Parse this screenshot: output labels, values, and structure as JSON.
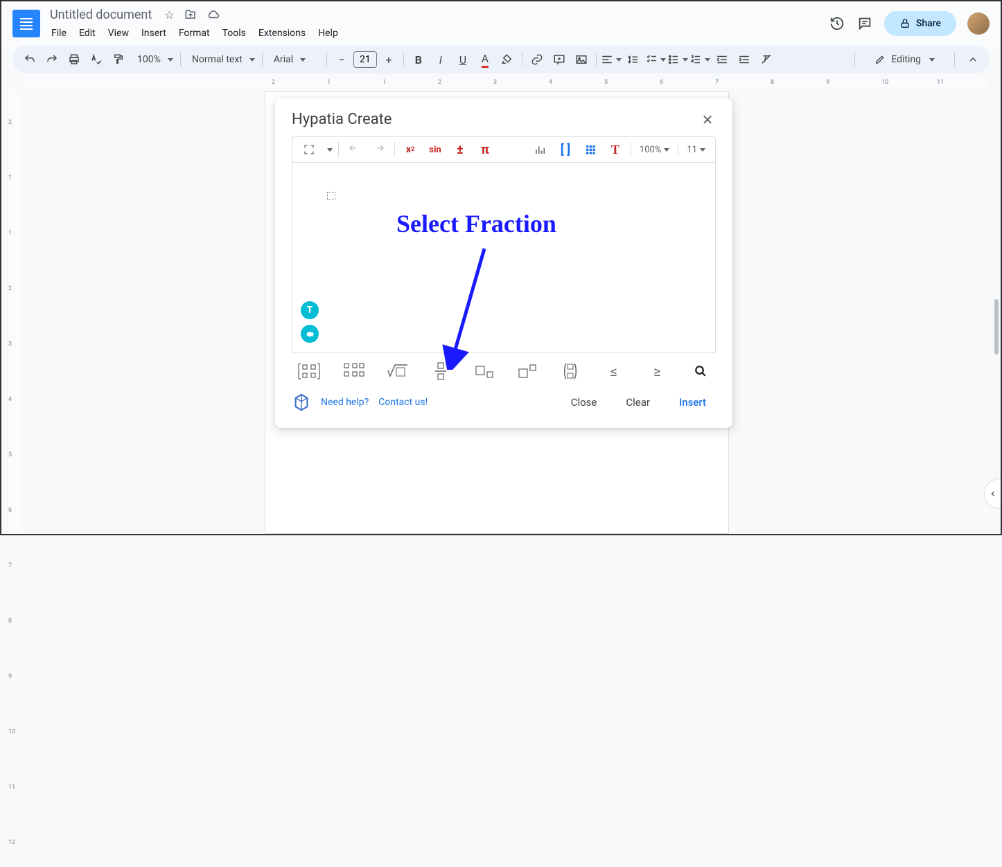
{
  "doc_title": "Untitled document",
  "menus": [
    "File",
    "Edit",
    "View",
    "Insert",
    "Format",
    "Tools",
    "Extensions",
    "Help"
  ],
  "share_label": "Share",
  "toolbar": {
    "zoom": "100%",
    "style": "Normal text",
    "font": "Arial",
    "font_size": "21",
    "editing_label": "Editing"
  },
  "modal": {
    "title": "Hypatia Create",
    "zoom": "100%",
    "font_size": "11",
    "help_label": "Need help?",
    "contact_label": "Contact us!",
    "close_label": "Close",
    "clear_label": "Clear",
    "insert_label": "Insert"
  },
  "annotation_text": "Select Fraction"
}
